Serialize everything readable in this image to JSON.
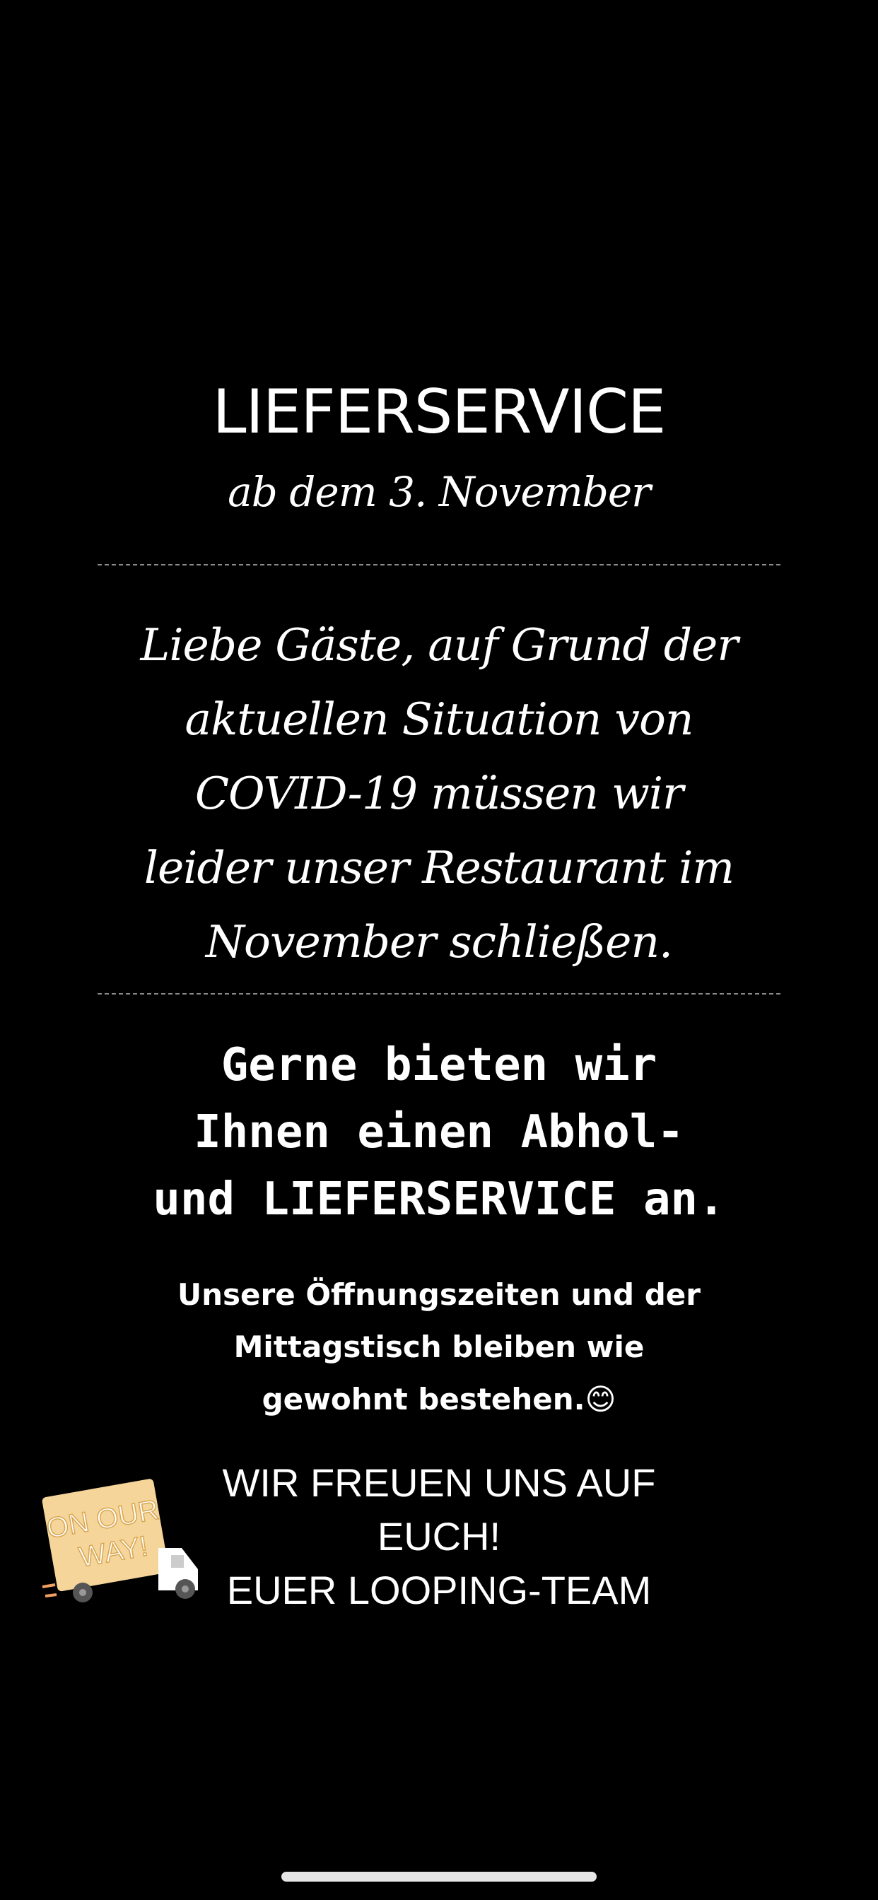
{
  "story": {
    "title": "LIEFERSERVICE",
    "subtitle": "ab dem 3. November",
    "notice_lines": [
      "Liebe Gäste, auf Grund der",
      "aktuellen Situation von",
      "COVID-19 müssen wir",
      "leider unser Restaurant im",
      "November schließen."
    ],
    "offer_lines": [
      "Gerne bieten wir",
      "Ihnen einen Abhol-",
      "und LIEFERSERVICE an."
    ],
    "hours_lines": [
      "Unsere Öffnungszeiten und der",
      "Mittagstisch bleiben wie",
      "gewohnt bestehen.😊"
    ],
    "closing_lines": [
      "WIR FREUEN UNS AUF",
      "EUCH!",
      "EUER LOOPING-TEAM"
    ],
    "sticker": {
      "icon": "delivery-truck-icon",
      "text_line1": "ON OUR",
      "text_line2": "WAY!"
    }
  },
  "colors": {
    "background": "#000000",
    "text": "#ffffff",
    "sticker_box": "#f5d59a",
    "divider": "#8a8a8a"
  }
}
